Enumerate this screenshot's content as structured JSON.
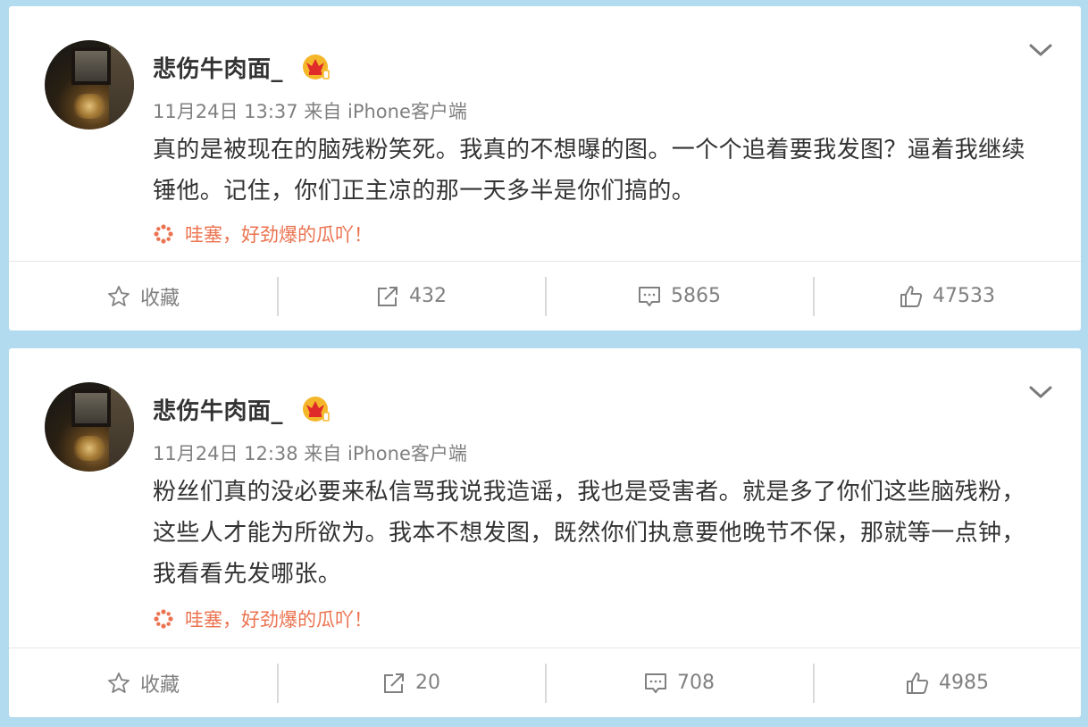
{
  "colors": {
    "page_bg": "#b3dbf0",
    "card_bg": "#ffffff",
    "username": "#333333",
    "meta": "#808080",
    "tag": "#eb7350",
    "crown_gold": "#f5b72a",
    "crown_red": "#e02b2b"
  },
  "posts": [
    {
      "username": "悲伤牛肉面_",
      "badge_icon": "crown-icon",
      "meta": "11月24日 13:37 来自 iPhone客户端",
      "text": "真的是被现在的脑残粉笑死。我真的不想曝的图。一个个追着要我发图？逼着我继续锤他。记住，你们正主凉的那一天多半是你们搞的。",
      "tag_icon": "gossip-flower-icon",
      "tag": "哇塞，好劲爆的瓜吖！",
      "actions": {
        "favorite_label": "收藏",
        "reposts": "432",
        "comments": "5865",
        "likes": "47533"
      }
    },
    {
      "username": "悲伤牛肉面_",
      "badge_icon": "crown-icon",
      "meta": "11月24日 12:38 来自 iPhone客户端",
      "text": "粉丝们真的没必要来私信骂我说我造谣，我也是受害者。就是多了你们这些脑残粉，这些人才能为所欲为。我本不想发图，既然你们执意要他晚节不保，那就等一点钟，我看看先发哪张。",
      "tag_icon": "gossip-flower-icon",
      "tag": "哇塞，好劲爆的瓜吖！",
      "actions": {
        "favorite_label": "收藏",
        "reposts": "20",
        "comments": "708",
        "likes": "4985"
      }
    }
  ]
}
